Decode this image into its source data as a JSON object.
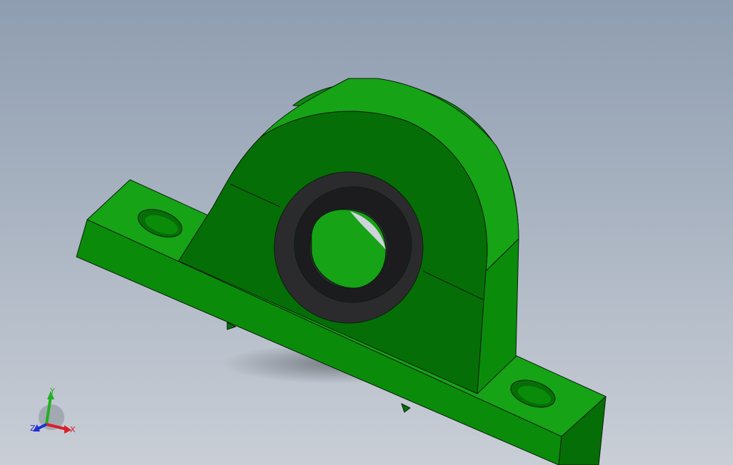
{
  "viewport": {
    "background_top": "#8e9db0",
    "background_bottom": "#c9ced6"
  },
  "model": {
    "housing_color": "#0a8c0a",
    "housing_dark": "#066e06",
    "housing_light": "#16a316",
    "edge_color": "#0b1e0b",
    "bearing_ring_color": "#2b2b2e",
    "bearing_ring_dark": "#1c1c1f"
  },
  "triad": {
    "x_label": "X",
    "y_label": "Y",
    "z_label": "Z",
    "x_color": "#d8202a",
    "y_color": "#22b022",
    "z_color": "#2030d0"
  }
}
